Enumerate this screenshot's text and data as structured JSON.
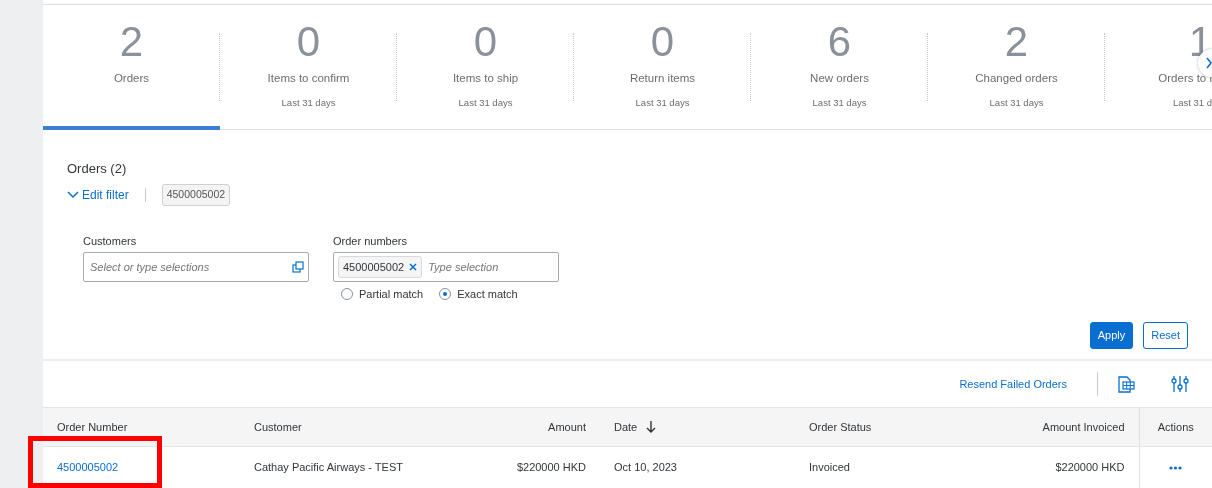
{
  "kpi_tiles": [
    {
      "value": "2",
      "label": "Orders",
      "selected": true
    },
    {
      "value": "0",
      "label": "Items to confirm",
      "period": "Last 31 days",
      "selected": false
    },
    {
      "value": "0",
      "label": "Items to ship",
      "period": "Last 31 days",
      "selected": false
    },
    {
      "value": "0",
      "label": "Return items",
      "period": "Last 31 days",
      "selected": false
    },
    {
      "value": "6",
      "label": "New orders",
      "period": "Last 31 days",
      "selected": false
    },
    {
      "value": "2",
      "label": "Changed orders",
      "period": "Last 31 days",
      "selected": false
    },
    {
      "value": "1",
      "label": "Orders to i",
      "period": "Last 31 d",
      "selected": false
    }
  ],
  "filter": {
    "title": "Orders (2)",
    "edit_link": "Edit filter",
    "active_token": "4500005002",
    "fields": [
      {
        "kind": "select",
        "label": "Customers",
        "placeholder": "Select or type selections"
      },
      {
        "kind": "tokens",
        "label": "Order numbers",
        "tokens": [
          "4500005002"
        ],
        "placeholder": "Type selection",
        "options": [
          {
            "label": "Partial match",
            "selected": false
          },
          {
            "label": "Exact match",
            "selected": true
          }
        ]
      }
    ],
    "buttons": [
      {
        "label": "Apply",
        "kind": "primary"
      },
      {
        "label": "Reset",
        "kind": "secondary"
      }
    ]
  },
  "toolbar": {
    "link": "Resend Failed Orders"
  },
  "table": {
    "columns": [
      {
        "label": "Order Number",
        "sorted": false,
        "highlighted": true
      },
      {
        "label": "Customer",
        "sorted": false,
        "highlighted": false
      },
      {
        "label": "Amount",
        "sorted": false,
        "highlighted": false
      },
      {
        "label": "Date",
        "sorted": true,
        "highlighted": false
      },
      {
        "label": "Order Status",
        "sorted": false,
        "highlighted": false
      },
      {
        "label": "Amount Invoiced",
        "sorted": false,
        "highlighted": false
      },
      {
        "label": "Actions",
        "sorted": false,
        "highlighted": false
      }
    ],
    "rows": [
      {
        "cells": [
          "4500005002",
          "Cathay Pacific Airways - TEST",
          "$220000 HKD",
          "Oct 10, 2023",
          "Invoiced",
          "$220000 HKD"
        ]
      }
    ]
  }
}
